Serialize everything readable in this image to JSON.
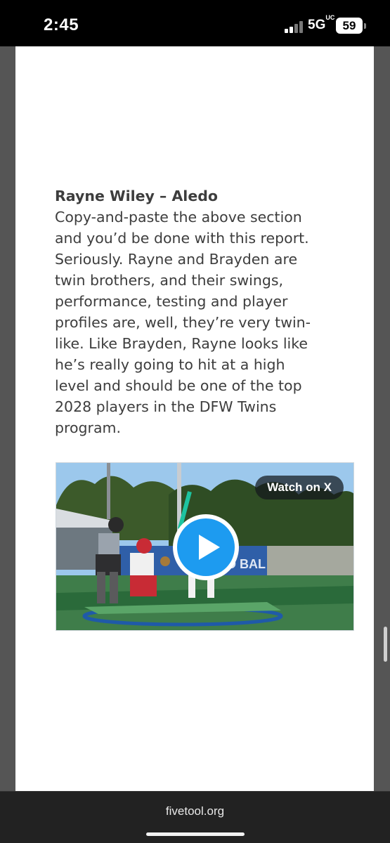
{
  "status_bar": {
    "time": "2:45",
    "network": "5G",
    "network_suffix": "UC",
    "battery": "59"
  },
  "article": {
    "heading": "Rayne Wiley – Aledo",
    "paragraph": "Copy-and-paste the above section and you’d be done with this report. Seriously. Rayne and Brayden are twin brothers, and their swings, performance, testing and player profiles are, well, they’re very twin-like. Like Brayden, Rayne looks like he’s really going to hit at a high level and should be one of the top 2028 players in the DFW Twins program."
  },
  "video": {
    "watch_label": "Watch on X",
    "banner_text": "ROO BAL",
    "play_icon": "play-icon",
    "accent_color": "#1d9bf0"
  },
  "browser": {
    "url": "fivetool.org"
  }
}
